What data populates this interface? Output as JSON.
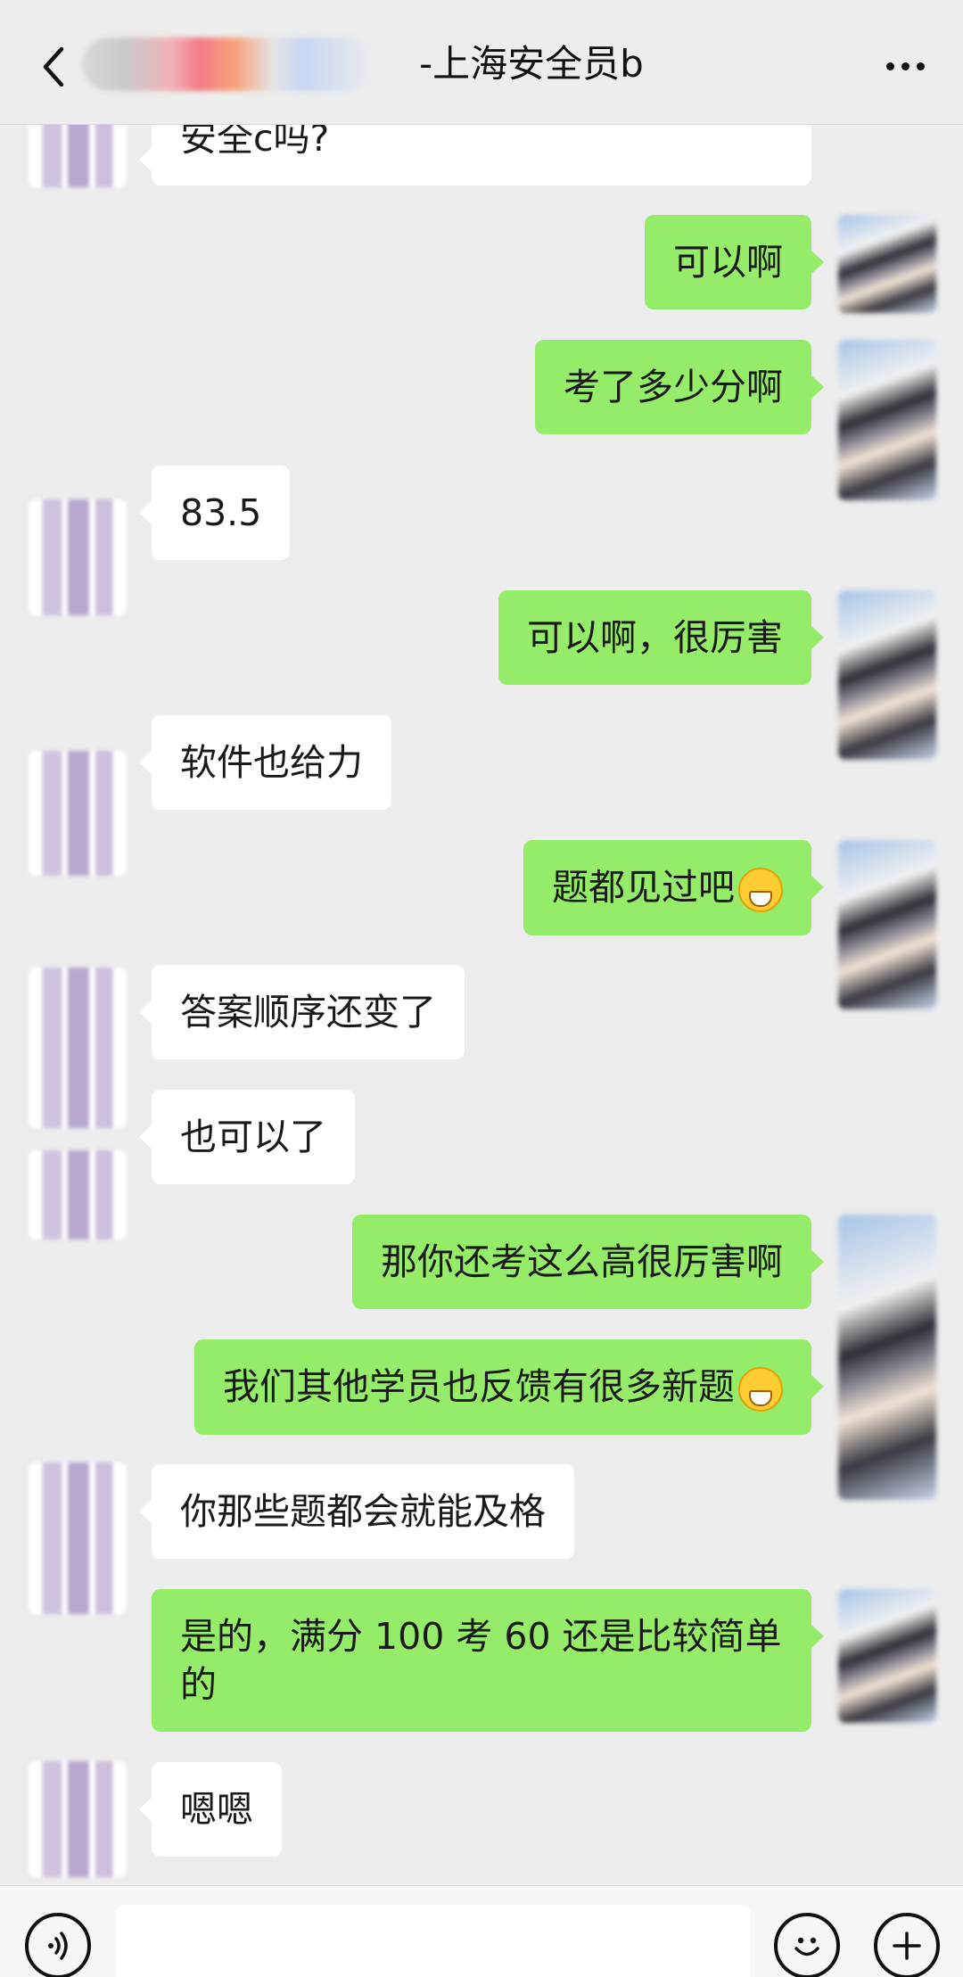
{
  "header": {
    "title": "-上海安全员b",
    "back_icon": "chevron-left-icon",
    "more_icon": "ellipsis-icon"
  },
  "messages": [
    {
      "from": "other",
      "text": "安全c吗?"
    },
    {
      "from": "me",
      "text": "可以啊"
    },
    {
      "from": "me",
      "text": "考了多少分啊"
    },
    {
      "from": "other",
      "text": "83.5"
    },
    {
      "from": "me",
      "text": "可以啊，很厉害"
    },
    {
      "from": "other",
      "text": "软件也给力"
    },
    {
      "from": "me",
      "text": "题都见过吧",
      "emoji": "grinning-face-icon"
    },
    {
      "from": "other",
      "text": "答案顺序还变了"
    },
    {
      "from": "other",
      "text": "也可以了"
    },
    {
      "from": "me",
      "text": "那你还考这么高很厉害啊"
    },
    {
      "from": "me",
      "text": "我们其他学员也反馈有很多新题",
      "emoji": "tears-of-joy-icon"
    },
    {
      "from": "other",
      "text": "你那些题都会就能及格"
    },
    {
      "from": "me",
      "text": "是的，满分 100 考 60 还是比较简单的"
    },
    {
      "from": "other",
      "text": "嗯嗯"
    }
  ],
  "colors": {
    "background": "#ededed",
    "outgoing_bubble": "#95ec69",
    "incoming_bubble": "#ffffff"
  },
  "input_bar": {
    "voice_icon": "voice-icon",
    "emoji_icon": "smile-icon",
    "plus_icon": "plus-icon"
  }
}
